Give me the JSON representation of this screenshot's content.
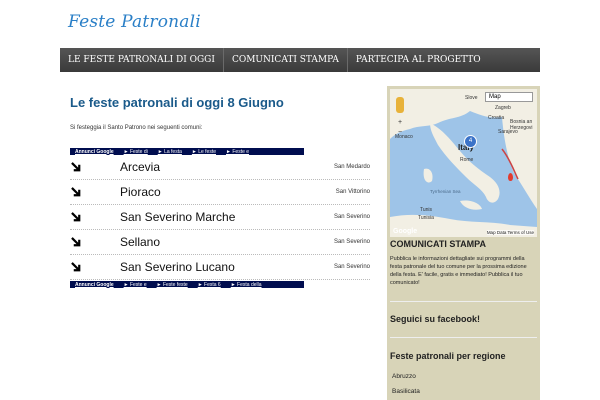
{
  "site": {
    "logo": "Feste Patronali"
  },
  "nav": {
    "items": [
      "LE FESTE PATRONALI DI OGGI",
      "COMUNICATI STAMPA",
      "PARTECIPA AL PROGETTO"
    ]
  },
  "main": {
    "title": "Le feste patronali di oggi 8 Giugno",
    "intro": "Si festeggia il Santo Patrono nei seguenti comuni:",
    "ads_top": [
      "Annunci Google",
      "► Feste di",
      "► La festa",
      "► Le feste",
      "► Feste e"
    ],
    "ads_bottom": [
      "Annunci Google",
      "► Feste e",
      "► Feste feste",
      "► Festa 6",
      "► Festa della"
    ],
    "rows": [
      {
        "name": "Arcevia",
        "patron": "San Medardo"
      },
      {
        "name": "Pioraco",
        "patron": "San Vittorino"
      },
      {
        "name": "San Severino Marche",
        "patron": "San Severino"
      },
      {
        "name": "Sellano",
        "patron": "San Severino"
      },
      {
        "name": "San Severino Lucano",
        "patron": "San Severino"
      }
    ]
  },
  "map": {
    "type_label": "Map",
    "labels": [
      "Slove",
      "Zagreb",
      "Croatia",
      "Bosnia an",
      "Herzegovi",
      "Monaco",
      "Italy",
      "Rome",
      "Tyrrhenian Sea",
      "Tunis",
      "Tunisia",
      "Sarajevo"
    ],
    "footer": "Map Data   Terms of Use",
    "google": "Google",
    "marker_count": "4"
  },
  "sidebar": {
    "press_title": "COMUNICATI STAMPA",
    "press_text": "Pubblica le informazioni dettagliate sui programmi della festa patronale del tuo comune per la prossima edizione della festa. E' facile, gratis e immediato! Pubblica il tuo comunicato!",
    "facebook_title": "Seguici su facebook!",
    "regions_title": "Feste patronali per regione",
    "regions": [
      "Abruzzo",
      "Basilicata"
    ]
  },
  "colors": {
    "accent": "#2a7fc7",
    "nav_bg": "#444444",
    "ad_bar": "#000d4f",
    "sidebar_bg": "#d8d4b8"
  }
}
